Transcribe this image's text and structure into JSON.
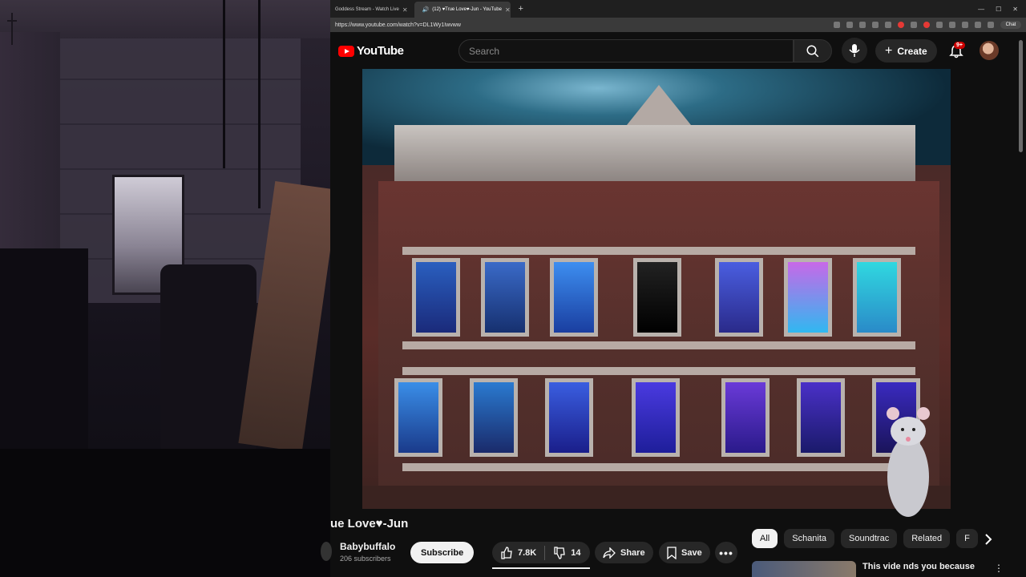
{
  "browser": {
    "tabs": [
      {
        "title": "Goddess Stream - Watch Live",
        "active": false
      },
      {
        "title": "(12) ♥True Love♥-Jun - YouTube",
        "active": true
      }
    ],
    "new_tab": "+",
    "url": "https://www.youtube.com/watch?v=DL1Wy1Iwvww",
    "chat_label": "Chat"
  },
  "youtube": {
    "logo_text": "YouTube",
    "search_placeholder": "Search",
    "create_label": "Create",
    "notif_badge": "9+",
    "video": {
      "title": "ue Love♥-Jun",
      "channel": "Babybuffalo",
      "subscribers": "206 subscribers",
      "subscribe_label": "Subscribe",
      "likes": "7.8K",
      "dislikes": "14",
      "share_label": "Share",
      "save_label": "Save"
    },
    "chips": [
      "All",
      "Schanita",
      "Soundtrac",
      "Related",
      "F"
    ],
    "selected_chip": "All",
    "recommendation": {
      "title": "This vide   nds you because"
    }
  },
  "colors": {
    "brand": "#ff0000",
    "background": "#0f0f0f",
    "pill": "#272727",
    "badge": "#cc0000"
  }
}
